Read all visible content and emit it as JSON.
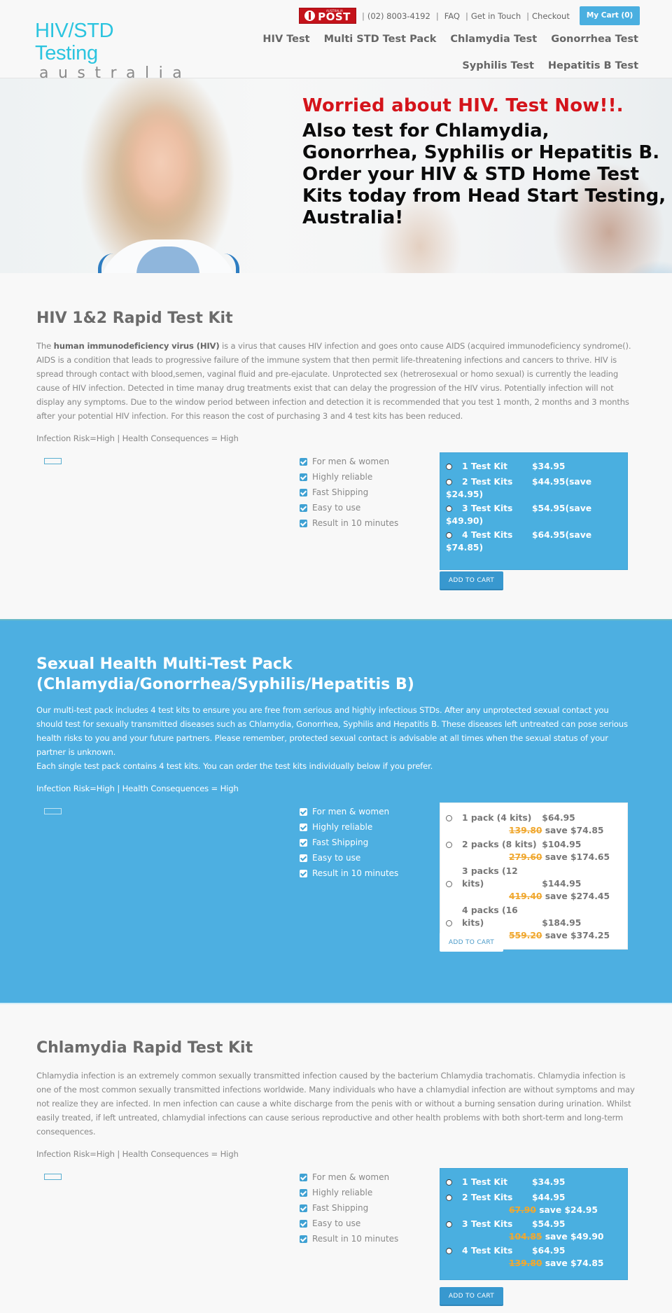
{
  "header": {
    "logo": {
      "main": "HIV/STD Testing",
      "sub": "australia"
    },
    "auspost": {
      "small": "AUSTRALIA",
      "text": "POST"
    },
    "topbar": {
      "phone": "(02) 8003-4192",
      "links": [
        "FAQ",
        "Get in Touch",
        "Checkout"
      ],
      "cart_label": "My Cart (0)"
    },
    "nav": [
      "HIV Test",
      "Multi STD Test Pack",
      "Chlamydia Test",
      "Gonorrhea Test",
      "Syphilis Test",
      "Hepatitis B Test"
    ]
  },
  "hero": {
    "headline_red": "Worried about HIV. Test Now!!.",
    "line1": "Also test for Chlamydia, Gonorrhea, Syphilis or Hepatitis B.",
    "line2": "Order your HIV & STD Home Test Kits today from Head Start Testing, Australia!"
  },
  "features": [
    "For men & women",
    "Highly reliable",
    "Fast Shipping",
    "Easy to use",
    "Result in 10 minutes"
  ],
  "sections": [
    {
      "title": "HIV 1&2 Rapid Test Kit",
      "desc_bold": "human immunodeficiency virus (HIV)",
      "desc_pre": "The ",
      "desc_post": " is a virus that causes HIV infection and goes onto cause AIDS (acquired immunodeficiency syndrome(). AIDS is a condition that leads to progressive failure of the immune system that then permit life-threatening infections and cancers to thrive. HIV is spread through contact with blood,semen, vaginal fluid and pre-ejaculate. Unprotected sex (hetrerosexual or homo sexual) is currently the leading cause of HIV infection. Detected in time manay drug treatments exist that can delay the progression of the HIV virus. Potentially infection will not display any symptoms. Due to the window period between infection and detection it is recommended that you test 1 month, 2 months and 3 months after your potential HIV infection. For this reason the cost of purchasing 3 and 4 test kits has been reduced.",
      "risk": "Infection Risk=High | Health Consequences = High",
      "options": [
        {
          "name": "1 Test Kit",
          "price": "$34.95"
        },
        {
          "name": "2 Test Kits",
          "price": "$44.95(save",
          "cont": "$24.95)"
        },
        {
          "name": "3 Test Kits",
          "price": "$54.95(save",
          "cont": "$49.90)"
        },
        {
          "name": "4 Test Kits",
          "price": "$64.95(save",
          "cont": "$74.85)"
        }
      ],
      "button": "ADD TO CART"
    },
    {
      "title_line1": "Sexual Health Multi-Test Pack",
      "title_line2": "(Chlamydia/Gonorrhea/Syphilis/Hepatitis B)",
      "desc": "Our multi-test pack includes 4 test kits to ensure you are free from serious and highly infectious STDs. After any unprotected sexual contact you should test for sexually transmitted diseases such as Chlamydia, Gonorrhea, Syphilis and Hepatitis B. These diseases left untreated can pose serious health risks to you and your future partners. Please remember, protected sexual contact is advisable at all times when the sexual status of your partner is unknown.",
      "desc2": "Each single test pack contains 4 test kits. You can order the test kits individually below if you prefer.",
      "risk": "Infection Risk=High | Health Consequences = High",
      "options": [
        {
          "name": "1 pack (4 kits)",
          "price": "$64.95",
          "was": "139.80",
          "save_label": "save",
          "save": "$74.85"
        },
        {
          "name": "2 packs (8 kits)",
          "price": "$104.95",
          "was": "279.60",
          "save_label": "save",
          "save": "$174.65"
        },
        {
          "name": "3 packs (12 kits)",
          "price": "$144.95",
          "was": "419.40",
          "save_label": "save",
          "save": "$274.45"
        },
        {
          "name": "4 packs (16 kits)",
          "price": "$184.95",
          "was": "559.20",
          "save_label": "save",
          "save": "$374.25"
        }
      ],
      "button": "ADD TO CART"
    },
    {
      "title": "Chlamydia Rapid Test Kit",
      "desc": "Chlamydia infection is an extremely common sexually transmitted infection caused by the bacterium Chlamydia trachomatis. Chlamydia infection is one of the most common sexually transmitted infections worldwide. Many individuals who have a chlamydial infection are without symptoms and may not realize they are infected. In men infection can cause a white discharge from the penis with or without a burning sensation during urination. Whilst easily treated, if left untreated, chlamydial infections can cause serious reproductive and other health problems with both short-term and long-term consequences.",
      "risk": "Infection Risk=High | Health Consequences = High",
      "options": [
        {
          "name": "1 Test Kit",
          "price": "$34.95"
        },
        {
          "name": "2 Test Kits",
          "price": "$44.95",
          "was": "67.90",
          "save_label": "save",
          "save": "$24.95"
        },
        {
          "name": "3 Test Kits",
          "price": "$54.95",
          "was": "104.85",
          "save_label": "save",
          "save": "$49.90"
        },
        {
          "name": "4 Test Kits",
          "price": "$64.95",
          "was": "139.80",
          "save_label": "save",
          "save": "$74.85"
        }
      ],
      "button": "ADD TO CART"
    }
  ]
}
